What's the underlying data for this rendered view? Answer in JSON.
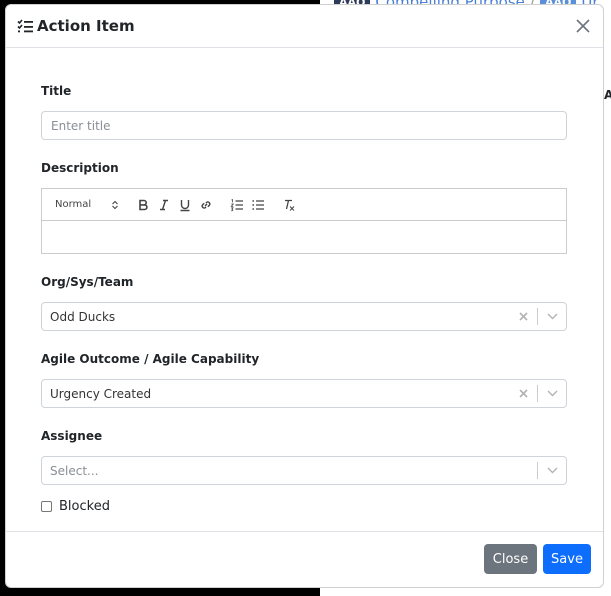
{
  "background": {
    "badge1": "AAQ",
    "link1": "Compelling Purpose",
    "separator": "/",
    "badge2": "AAQ",
    "link2": "Ur",
    "edge_letter": "A"
  },
  "modal": {
    "title": "Action Item",
    "title_icon": "list-check-icon",
    "close_icon": "close-icon"
  },
  "form": {
    "title": {
      "label": "Title",
      "placeholder": "Enter title",
      "value": ""
    },
    "description": {
      "label": "Description",
      "toolbar": {
        "header_select": "Normal",
        "buttons": [
          "bold-icon",
          "italic-icon",
          "underline-icon",
          "link-icon",
          "ordered-list-icon",
          "bullet-list-icon",
          "clear-format-icon"
        ]
      },
      "value": ""
    },
    "org": {
      "label": "Org/Sys/Team",
      "value": "Odd Ducks"
    },
    "outcome": {
      "label": "Agile Outcome / Agile Capability",
      "value": "Urgency Created"
    },
    "assignee": {
      "label": "Assignee",
      "placeholder": "Select..."
    },
    "blocked": {
      "label": "Blocked",
      "checked": false
    }
  },
  "footer": {
    "close_label": "Close",
    "save_label": "Save"
  },
  "colors": {
    "primary": "#0d6efd",
    "secondary": "#6c757d"
  }
}
